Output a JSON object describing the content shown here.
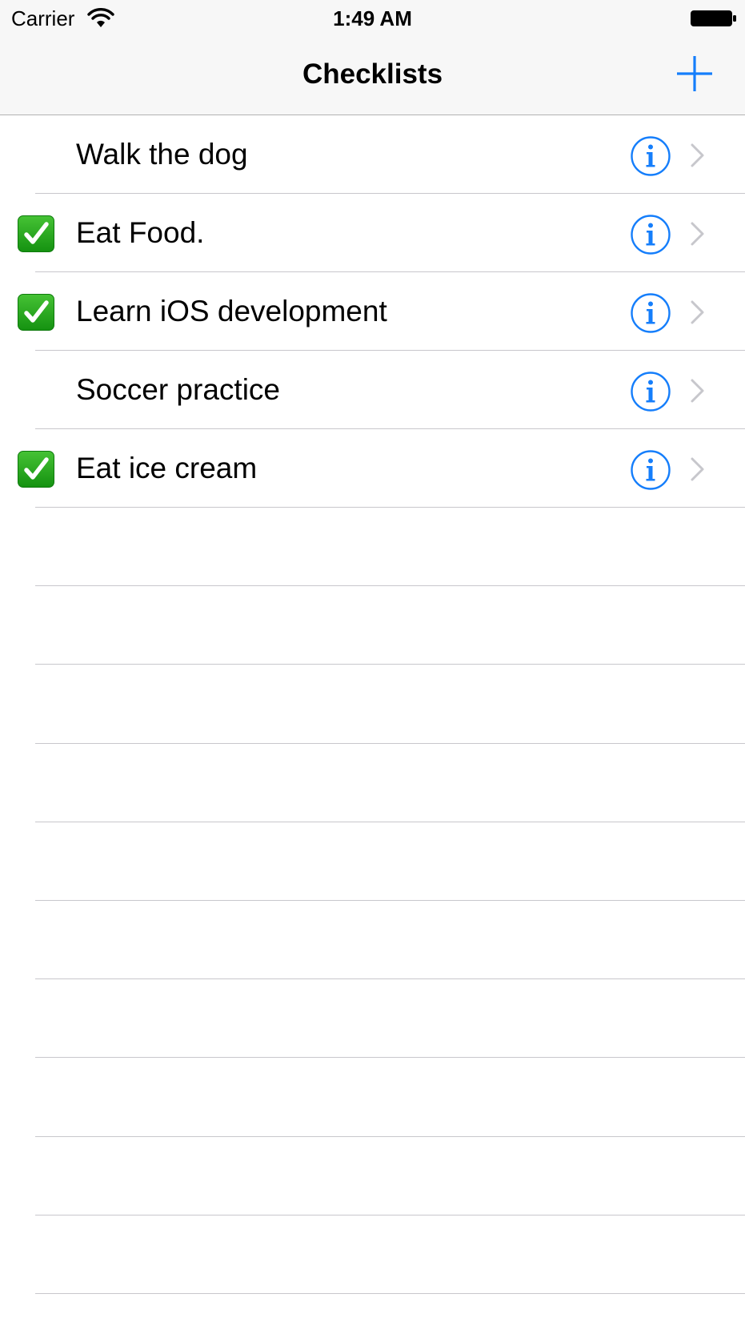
{
  "status_bar": {
    "carrier": "Carrier",
    "time": "1:49 AM"
  },
  "nav": {
    "title": "Checklists",
    "add_icon": "plus-icon"
  },
  "colors": {
    "accent": "#157efb",
    "check_green": "#2aa822",
    "separator": "#c8c7cc",
    "chevron": "#c7c7cc"
  },
  "items": [
    {
      "label": "Walk the dog",
      "checked": false
    },
    {
      "label": "Eat Food.",
      "checked": true
    },
    {
      "label": "Learn iOS development",
      "checked": true
    },
    {
      "label": "Soccer practice",
      "checked": false
    },
    {
      "label": "Eat ice cream",
      "checked": true
    }
  ]
}
